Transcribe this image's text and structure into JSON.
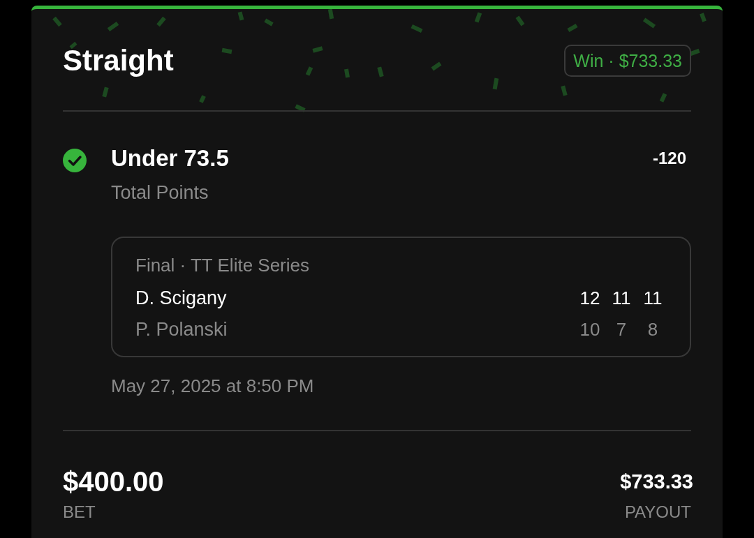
{
  "bet": {
    "type": "Straight",
    "won": true,
    "status_badge": "Win · $733.33"
  },
  "selection": {
    "won": true,
    "title": "Under 73.5",
    "odds": "-120",
    "market": "Total Points"
  },
  "event": {
    "header": "Final · TT Elite Series",
    "players": [
      {
        "name": "D. Scigany",
        "winner": true,
        "scores": [
          "12",
          "11",
          "11"
        ]
      },
      {
        "name": "P. Polanski",
        "winner": false,
        "scores": [
          "10",
          "7",
          "8"
        ]
      }
    ]
  },
  "placed_at": "May 27, 2025 at 8:50 PM",
  "totals": {
    "bet_amount": "$400.00",
    "bet_label": "BET",
    "payout_amount": "$733.33",
    "payout_label": "PAYOUT"
  }
}
